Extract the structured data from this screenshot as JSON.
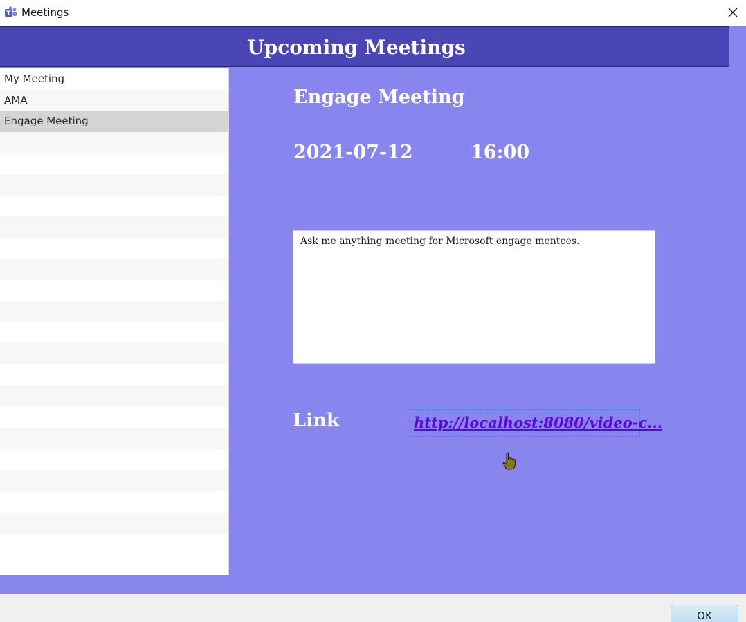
{
  "window": {
    "title": "Meetings",
    "app_icon": "teams-icon",
    "close_icon": "close-icon"
  },
  "header": {
    "title": "Upcoming Meetings"
  },
  "meeting_list": {
    "items": [
      {
        "label": "My Meeting",
        "selected": false
      },
      {
        "label": "AMA",
        "selected": false
      },
      {
        "label": "Engage Meeting",
        "selected": true
      }
    ]
  },
  "detail": {
    "title": "Engage Meeting",
    "date": "2021-07-12",
    "time": "16:00",
    "description": "Ask me anything meeting for Microsoft engage mentees.",
    "link_label": "Link",
    "link_text": "http://localhost:8080/video-c..."
  },
  "footer": {
    "ok_label": "OK"
  },
  "colors": {
    "banner": "#4a46b6",
    "panel": "#8886ee",
    "link": "#5b0ad6",
    "selected_row": "#d5d3d6"
  }
}
